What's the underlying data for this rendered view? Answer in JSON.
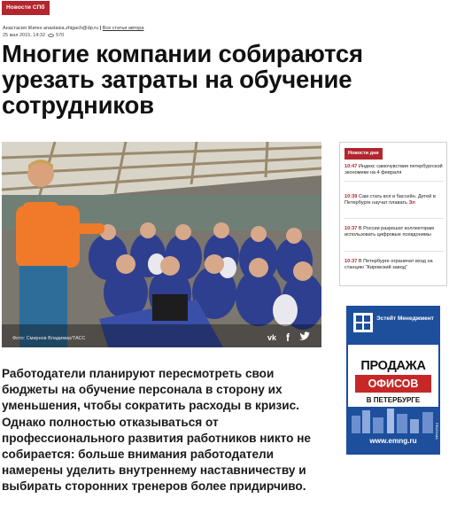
{
  "section": {
    "label": "Новости СПб"
  },
  "byline": {
    "author": "Анастасия Жиген anastasia.zhigach@dp.ru",
    "separator": "|",
    "all_articles": "Все статьи автора"
  },
  "meta": {
    "date": "25 мая 2015, 14:32",
    "views": "570"
  },
  "headline": "Многие компании собираются урезать затраты на обучение сотрудников",
  "photo": {
    "caption": "Фото: Смирнов Владимир/ТАСС"
  },
  "share": {
    "vk": "vk-icon",
    "facebook": "facebook-icon",
    "twitter": "twitter-icon"
  },
  "lead": "Работодатели планируют пересмотреть свои бюджеты на обучение персонала в сторону их уменьшения, чтобы сократить расходы в кризис. Однако полностью отказываться от профессионального развития работников никто не собирается: больше внимания работодатели намерены уделить внутреннему наставничеству и выбирать сторонних тренеров более придирчиво.",
  "news_box": {
    "badge": "Новости дня",
    "items": [
      {
        "time": "10:47",
        "text": "Индекс самочувствия петербургской экономики на 4 февраля",
        "tag": ""
      },
      {
        "time": "10:39",
        "text": "Сам стать вся в бассейн. Детей в Петербурге научат плавать",
        "tag": "Эл"
      },
      {
        "time": "10:37",
        "text": "В России разрешат коллекторам использовать цифровые псевдонимы",
        "tag": ""
      },
      {
        "time": "10:37",
        "text": "В Петербурге ограничат вход на станцию \"Кировский завод\"",
        "tag": ""
      }
    ]
  },
  "ad": {
    "brand": "Эстейт Менеджмент",
    "title": "ПРОДАЖА",
    "highlight": "ОФИСОВ",
    "city": "В ПЕТЕРБУРГЕ",
    "url": "www.emng.ru",
    "mark": "РЕКЛАМА"
  },
  "colors": {
    "accent": "#b3262e",
    "ad_blue": "#1d4f9c",
    "ad_red": "#c62828"
  }
}
